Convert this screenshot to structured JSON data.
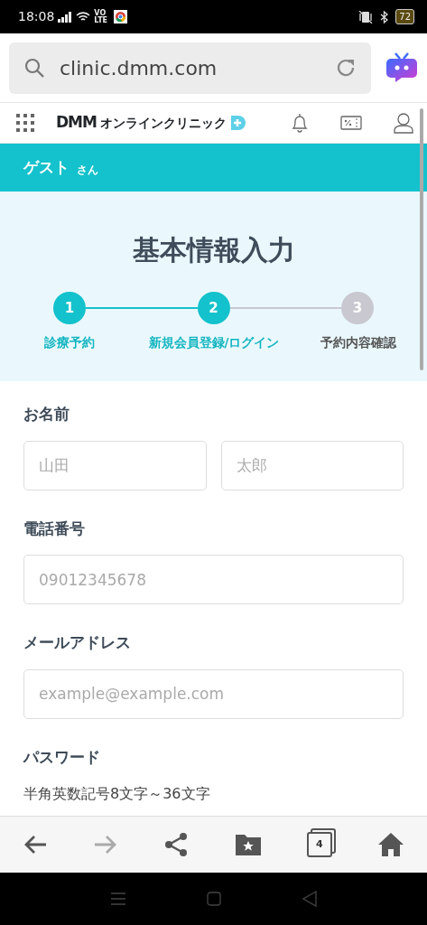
{
  "status_bar": {
    "time": "18:08",
    "network_label": "VO LTE",
    "battery": "72"
  },
  "browser": {
    "url": "clinic.dmm.com",
    "tab_count": "4"
  },
  "site_header": {
    "logo_brand": "DMM",
    "logo_service": "オンラインクリニック"
  },
  "user_bar": {
    "name": "ゲスト",
    "suffix": "さん"
  },
  "page_title": "基本情報入力",
  "steps": [
    {
      "number": "1",
      "label": "診療予約",
      "active": true
    },
    {
      "number": "2",
      "label": "新規会員登録/ログイン",
      "active": true
    },
    {
      "number": "3",
      "label": "予約内容確認",
      "active": false
    }
  ],
  "form": [
    {
      "label": "お名前",
      "fields": [
        {
          "placeholder": "山田"
        },
        {
          "placeholder": "太郎"
        }
      ]
    },
    {
      "label": "電話番号",
      "fields": [
        {
          "placeholder": "09012345678"
        }
      ]
    },
    {
      "label": "メールアドレス",
      "fields": [
        {
          "placeholder": "example@example.com"
        }
      ]
    },
    {
      "label": "パスワード",
      "hint": "半角英数記号8文字～36文字"
    }
  ]
}
